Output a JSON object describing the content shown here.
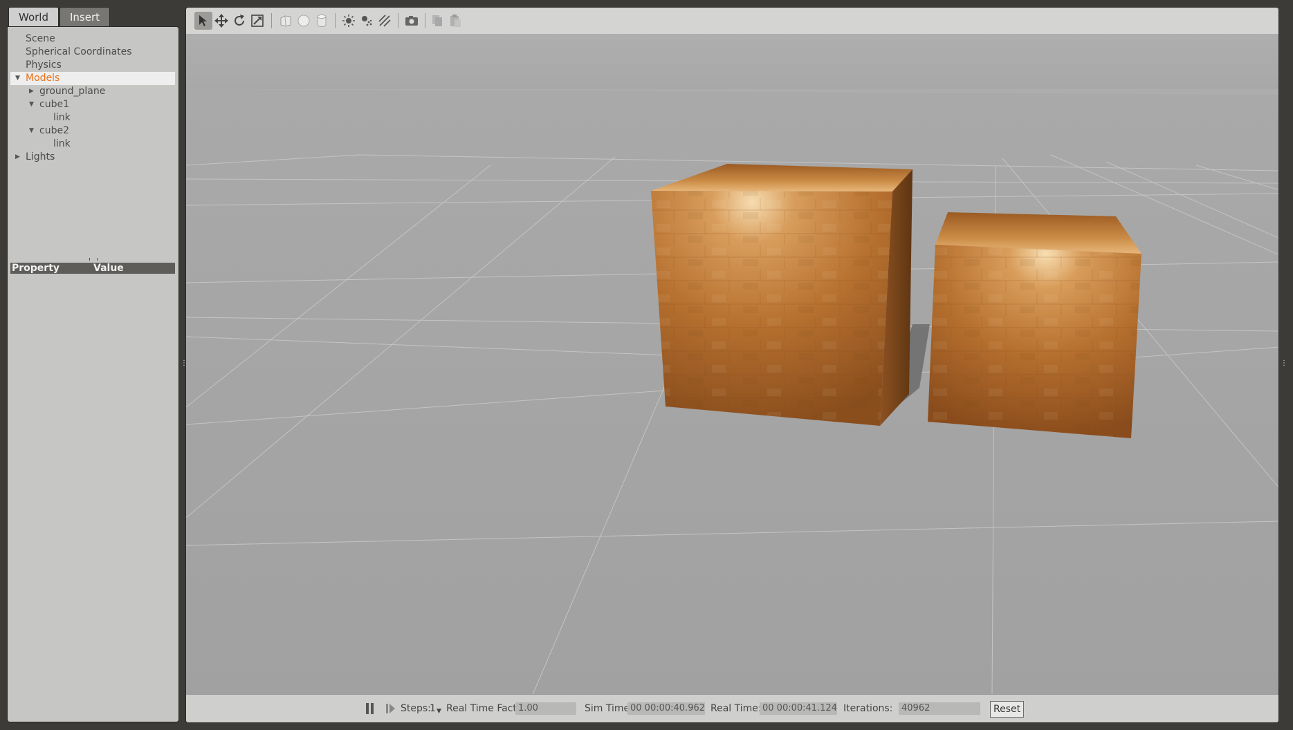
{
  "tabs": {
    "world": "World",
    "insert": "Insert"
  },
  "tree": {
    "scene": "Scene",
    "spherical_coordinates": "Spherical Coordinates",
    "physics": "Physics",
    "models": "Models",
    "ground_plane": "ground_plane",
    "cube1": "cube1",
    "cube1_link": "link",
    "cube2": "cube2",
    "cube2_link": "link",
    "lights": "Lights"
  },
  "properties": {
    "property_header": "Property",
    "value_header": "Value"
  },
  "toolbar": {
    "tools": [
      "select-mode-icon",
      "translate-mode-icon",
      "rotate-mode-icon",
      "scale-mode-icon",
      "box-shape-icon",
      "sphere-shape-icon",
      "cylinder-shape-icon",
      "point-light-icon",
      "spot-light-icon",
      "directional-light-icon",
      "screenshot-icon",
      "copy-icon",
      "paste-icon"
    ],
    "active_tool": "select-mode-icon"
  },
  "bottom_bar": {
    "steps_label": "Steps:",
    "steps_value": "1",
    "real_time_factor_label": "Real Time Factor:",
    "real_time_factor_value": "1.00",
    "sim_time_label": "Sim Time:",
    "sim_time_value": "00 00:00:40.962",
    "real_time_label": "Real Time:",
    "real_time_value": "00 00:00:41.124",
    "iterations_label": "Iterations:",
    "iterations_value": "40962",
    "reset_label": "Reset"
  },
  "colors": {
    "selection_text": "#e8731a",
    "sky": "#ababab",
    "ground": "#a3a3a3",
    "wood": "#b8712e"
  }
}
